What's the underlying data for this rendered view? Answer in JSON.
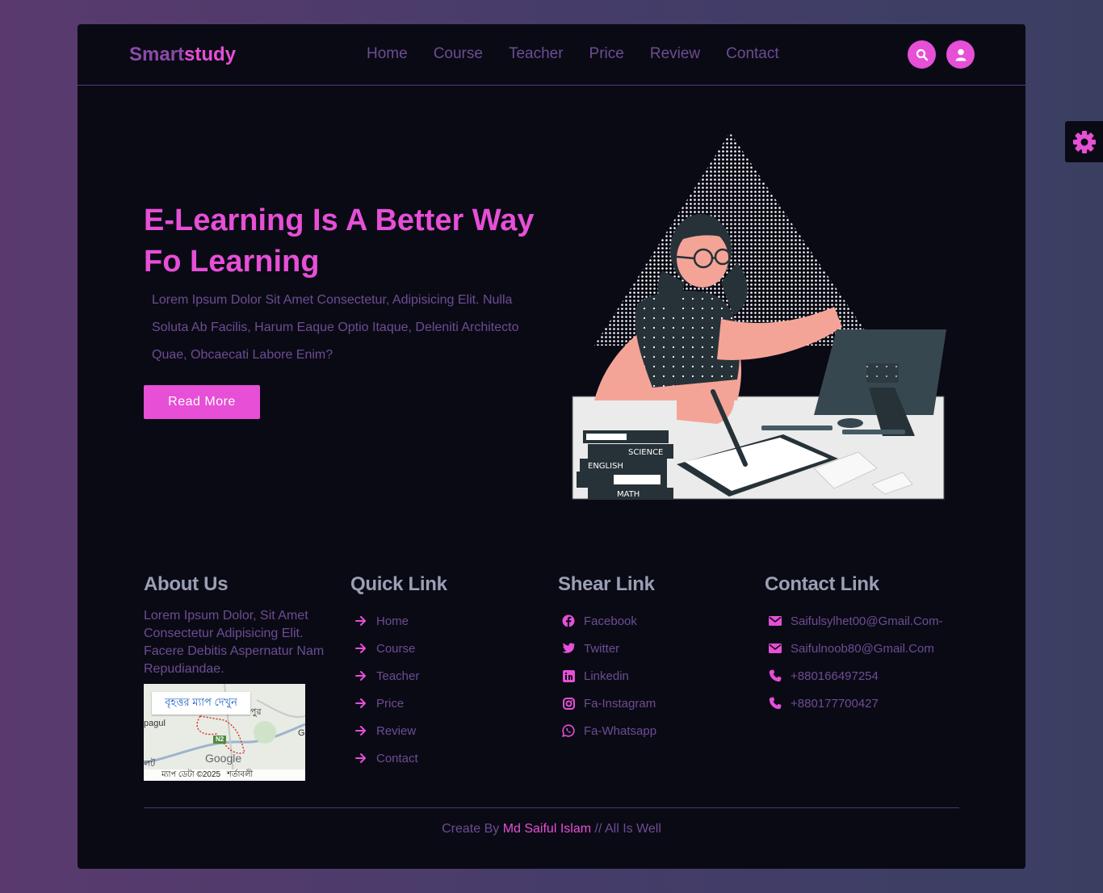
{
  "header": {
    "logo_part1": "Smart",
    "logo_part2": "study",
    "nav": [
      "Home",
      "Course",
      "Teacher",
      "Price",
      "Review",
      "Contact"
    ]
  },
  "hero": {
    "title": "E-Learning Is A Better Way Fo Learning",
    "text": "Lorem Ipsum Dolor Sit Amet Consectetur, Adipisicing Elit. Nulla Soluta Ab Facilis, Harum Eaque Optio Itaque, Deleniti Architecto Quae, Obcaecati Labore Enim?",
    "button": "Read More",
    "book_labels": [
      "SCIENCE",
      "ENGLISH",
      "MATH"
    ]
  },
  "footer": {
    "about": {
      "title": "About Us",
      "text": "Lorem Ipsum Dolor, Sit Amet Consectetur Adipisicing Elit. Facere Debitis Aspernatur Nam Repudiandae.",
      "map_badge": "বৃহত্তর ম্যাপ দেখুন",
      "map_data": "ম্যাপ ডেটা ©2025",
      "map_terms": "শর্তাবলী",
      "map_google": "Google",
      "map_road": "N2",
      "map_place1": "pagul",
      "map_place2": "পুর",
      "map_place3": "লট",
      "map_place4": "G"
    },
    "quick": {
      "title": "Quick Link",
      "items": [
        "Home",
        "Course",
        "Teacher",
        "Price",
        "Review",
        "Contact"
      ]
    },
    "share": {
      "title": "Shear Link",
      "items": [
        "Facebook",
        "Twitter",
        "Linkedin",
        "Fa-Instagram",
        "Fa-Whatsapp"
      ]
    },
    "contact": {
      "title": "Contact Link",
      "items": [
        "Saifulsylhet00@Gmail.Com-",
        "Saifulnoob80@Gmail.Com",
        "+880166497254",
        "+880177700427"
      ]
    },
    "credit_prefix": "Create By ",
    "credit_name": "Md Saiful Islam",
    "credit_suffix": " // All Is Well"
  },
  "colors": {
    "accent": "#e64fd6",
    "text_muted": "#6d4d92",
    "background": "#0a0a15",
    "heading": "#9aa0b4"
  }
}
